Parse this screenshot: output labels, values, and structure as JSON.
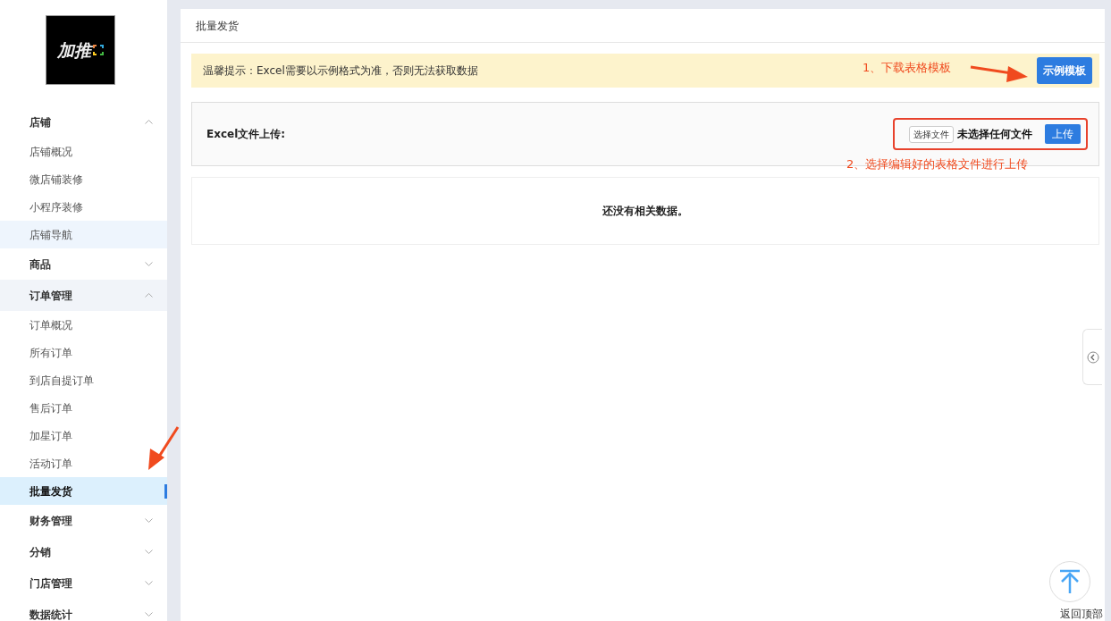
{
  "logo": {
    "text": "加推"
  },
  "sidebar": {
    "groups": [
      {
        "label": "店铺",
        "expanded": true,
        "hovered": false,
        "children": [
          {
            "label": "店铺概况",
            "selected": false,
            "hovered": false
          },
          {
            "label": "微店铺装修",
            "selected": false,
            "hovered": false
          },
          {
            "label": "小程序装修",
            "selected": false,
            "hovered": false
          },
          {
            "label": "店铺导航",
            "selected": false,
            "hovered": true
          }
        ]
      },
      {
        "label": "商品",
        "expanded": false,
        "hovered": false
      },
      {
        "label": "订单管理",
        "expanded": true,
        "hovered": true,
        "children": [
          {
            "label": "订单概况",
            "selected": false,
            "hovered": false
          },
          {
            "label": "所有订单",
            "selected": false,
            "hovered": false
          },
          {
            "label": "到店自提订单",
            "selected": false,
            "hovered": false
          },
          {
            "label": "售后订单",
            "selected": false,
            "hovered": false
          },
          {
            "label": "加星订单",
            "selected": false,
            "hovered": false
          },
          {
            "label": "活动订单",
            "selected": false,
            "hovered": false
          },
          {
            "label": "批量发货",
            "selected": true,
            "hovered": false
          }
        ]
      },
      {
        "label": "财务管理",
        "expanded": false,
        "hovered": false
      },
      {
        "label": "分销",
        "expanded": false,
        "hovered": false
      },
      {
        "label": "门店管理",
        "expanded": false,
        "hovered": false
      },
      {
        "label": "数据统计",
        "expanded": false,
        "hovered": false
      }
    ]
  },
  "page": {
    "title": "批量发货",
    "notice": "温馨提示：Excel需要以示例格式为准，否则无法获取数据",
    "template_button": "示例模板",
    "upload": {
      "label": "Excel文件上传:",
      "choose_button": "选择文件",
      "file_status": "未选择任何文件",
      "upload_button": "上传"
    },
    "empty_message": "还没有相关数据。"
  },
  "annotations": [
    "1、下载表格模板",
    "2、选择编辑好的表格文件进行上传"
  ],
  "back_to_top": {
    "label": "返回顶部"
  }
}
